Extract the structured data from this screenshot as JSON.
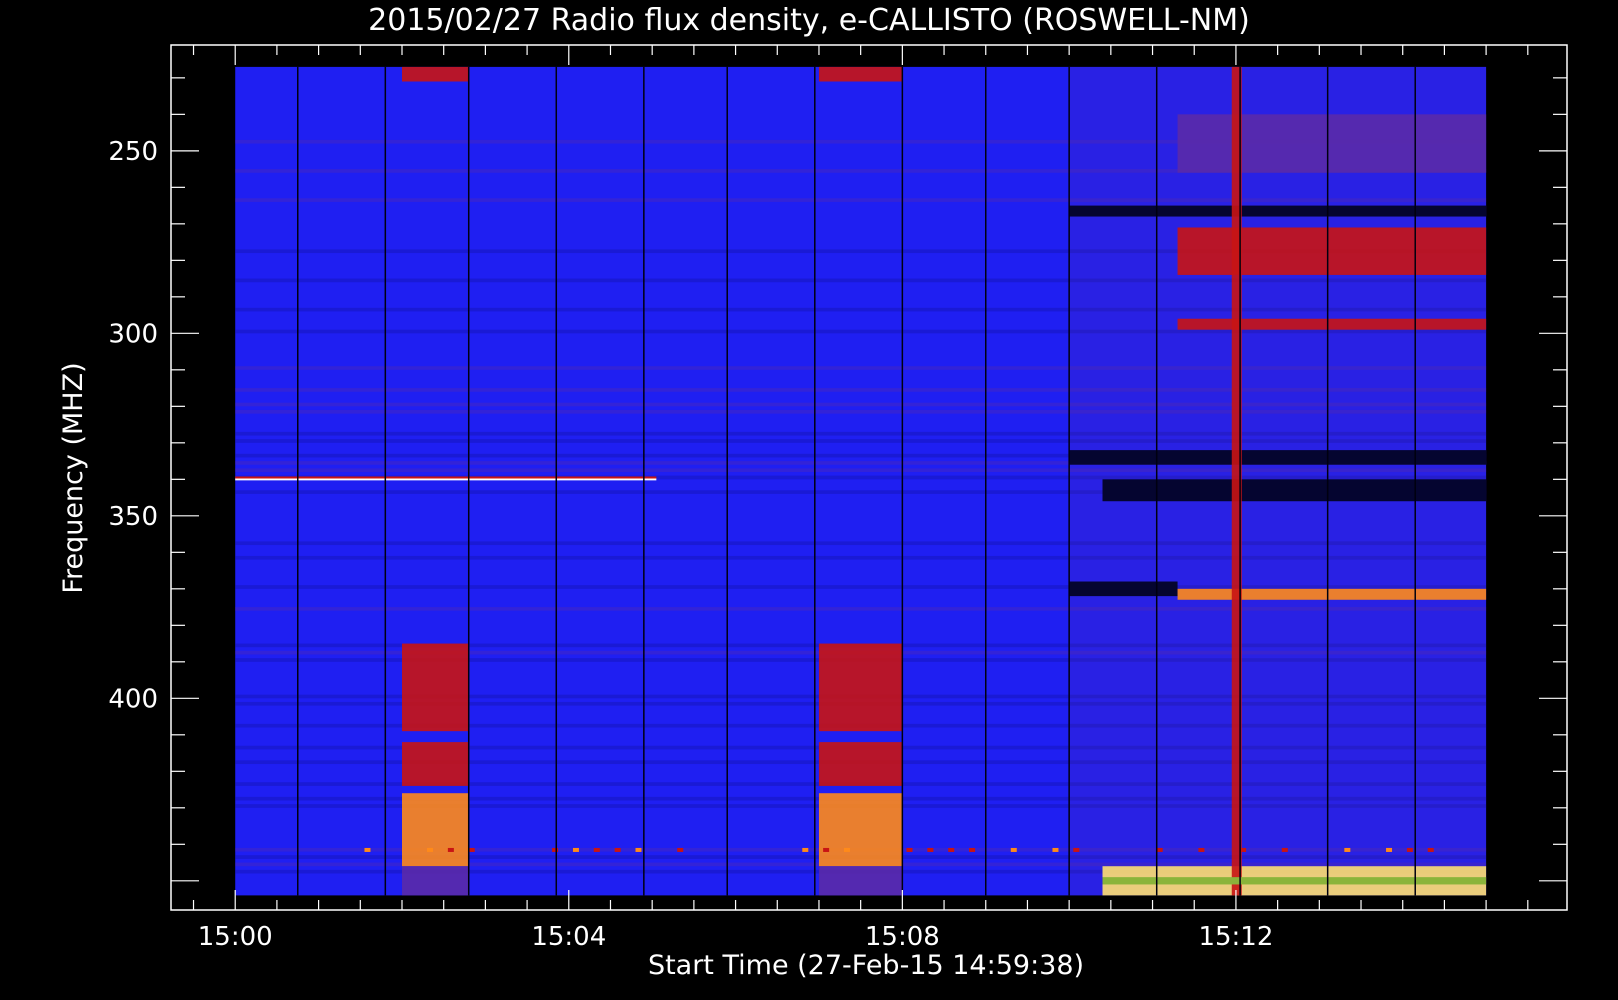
{
  "chart_data": {
    "type": "heatmap",
    "title": "2015/02/27  Radio flux density, e-CALLISTO (ROSWELL-NM)",
    "xlabel": "Start Time (27-Feb-15 14:59:38)",
    "ylabel": "Frequency (MHZ)",
    "x_ticks": [
      "15:00",
      "15:04",
      "15:08",
      "15:12"
    ],
    "y_ticks": [
      "250",
      "300",
      "350",
      "400"
    ],
    "x_range_minutes": [
      -0.77,
      15.97
    ],
    "y_range_mhz": [
      221,
      458
    ],
    "data_x_extent_minutes": [
      0.0,
      15.0
    ],
    "data_y_extent_mhz": [
      227,
      454
    ],
    "colors": {
      "background": "#000000",
      "base": "#1f1ff2",
      "dark": "#1010a0",
      "purple": "#5a2aa8",
      "red": "#c81414",
      "orange": "#ff8a1a",
      "yellow": "#ffe070",
      "white": "#ffffff",
      "green": "#8ab43a"
    },
    "bursts": [
      {
        "t0": 2.0,
        "t1": 2.8,
        "f0": 227,
        "f1": 231,
        "level": "red"
      },
      {
        "t0": 2.0,
        "t1": 2.8,
        "f0": 385,
        "f1": 409,
        "level": "red"
      },
      {
        "t0": 2.0,
        "t1": 2.8,
        "f0": 412,
        "f1": 424,
        "level": "red"
      },
      {
        "t0": 2.0,
        "t1": 2.8,
        "f0": 426,
        "f1": 446,
        "level": "orange"
      },
      {
        "t0": 2.0,
        "t1": 2.8,
        "f0": 446,
        "f1": 454,
        "level": "purple"
      },
      {
        "t0": 7.0,
        "t1": 8.0,
        "f0": 227,
        "f1": 231,
        "level": "red"
      },
      {
        "t0": 7.0,
        "t1": 8.0,
        "f0": 385,
        "f1": 409,
        "level": "red"
      },
      {
        "t0": 7.0,
        "t1": 8.0,
        "f0": 412,
        "f1": 424,
        "level": "red"
      },
      {
        "t0": 7.0,
        "t1": 8.0,
        "f0": 426,
        "f1": 446,
        "level": "orange"
      },
      {
        "t0": 7.0,
        "t1": 8.0,
        "f0": 446,
        "f1": 454,
        "level": "purple"
      },
      {
        "t0": 11.3,
        "t1": 15.0,
        "f0": 240,
        "f1": 256,
        "level": "purple"
      },
      {
        "t0": 11.3,
        "t1": 15.0,
        "f0": 271,
        "f1": 284,
        "level": "red"
      },
      {
        "t0": 11.3,
        "t1": 15.0,
        "f0": 296,
        "f1": 299,
        "level": "red"
      },
      {
        "t0": 11.3,
        "t1": 15.0,
        "f0": 370,
        "f1": 373,
        "level": "orange"
      },
      {
        "t0": 10.4,
        "t1": 15.0,
        "f0": 446,
        "f1": 454,
        "level": "yellow"
      },
      {
        "t0": 11.95,
        "t1": 12.07,
        "f0": 227,
        "f1": 454,
        "level": "red"
      }
    ],
    "lines": [
      {
        "t0": 0.0,
        "t1": 5.05,
        "f": 340,
        "color": "white"
      },
      {
        "t0": 0.0,
        "t1": 5.05,
        "f": 339.5,
        "color": "red"
      }
    ],
    "dark_bands": [
      {
        "t0": 10.0,
        "t1": 15.0,
        "f0": 265,
        "f1": 268
      },
      {
        "t0": 10.0,
        "t1": 15.0,
        "f0": 332,
        "f1": 336
      },
      {
        "t0": 10.4,
        "t1": 15.0,
        "f0": 340,
        "f1": 346
      },
      {
        "t0": 10.0,
        "t1": 11.3,
        "f0": 368,
        "f1": 372
      }
    ],
    "vertical_gaps_minutes": [
      0.75,
      1.8,
      2.8,
      3.85,
      4.9,
      5.9,
      6.95,
      8.0,
      9.0,
      10.0,
      11.05,
      12.05,
      13.1,
      14.15
    ]
  }
}
